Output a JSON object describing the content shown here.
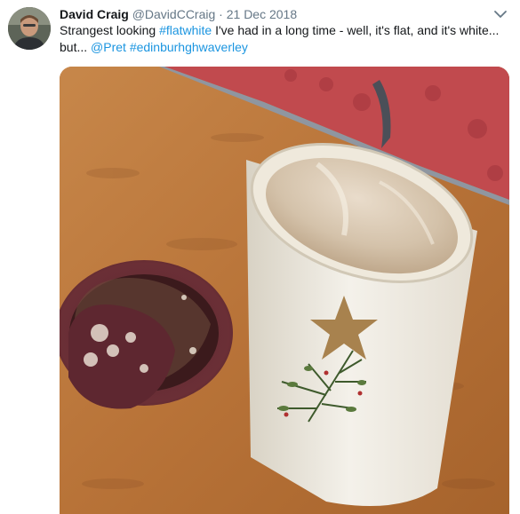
{
  "tweet": {
    "author_name": "David Craig",
    "author_handle": "@DavidCCraig",
    "separator": "·",
    "date": "21 Dec 2018",
    "text_prefix": "Strangest looking ",
    "hashtag_flatwhite": "#flatwhite",
    "text_middle": " I've had in a long time - well, it's flat, and it's white... but... ",
    "mention_pret": "@Pret",
    "text_space": " ",
    "hashtag_location": "#edinburhghwaverley"
  },
  "icons": {
    "avatar": "user-avatar",
    "menu_caret": "chevron-down-icon"
  },
  "colors": {
    "link": "#1b95e0",
    "secondary_text": "#657786",
    "primary_text": "#14171a"
  }
}
